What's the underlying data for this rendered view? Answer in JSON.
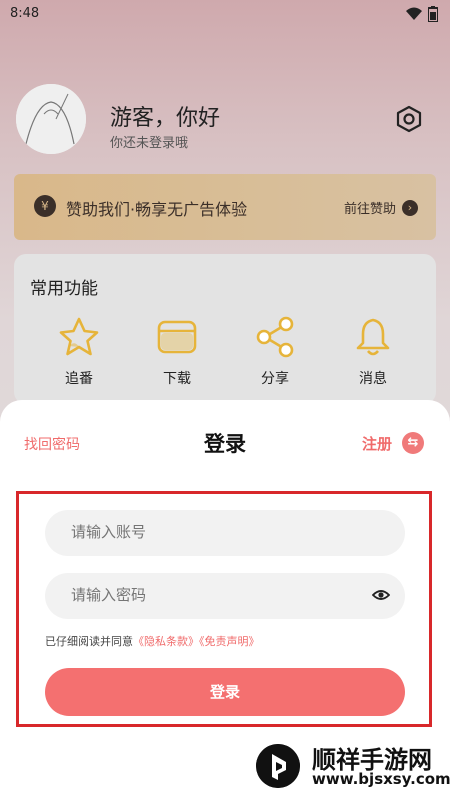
{
  "status_bar": {
    "time": "8:48"
  },
  "profile": {
    "greeting": "游客，你好",
    "subtitle": "你还未登录哦"
  },
  "sponsor": {
    "icon_text": "¥",
    "text": "赞助我们·畅享无广告体验",
    "action": "前往赞助"
  },
  "features": {
    "title": "常用功能",
    "items": [
      {
        "label": "追番",
        "icon": "star-icon"
      },
      {
        "label": "下载",
        "icon": "folder-icon"
      },
      {
        "label": "分享",
        "icon": "share-icon"
      },
      {
        "label": "消息",
        "icon": "bell-icon"
      }
    ]
  },
  "login_sheet": {
    "forgot": "找回密码",
    "title": "登录",
    "register": "注册",
    "account_placeholder": "请输入账号",
    "password_placeholder": "请输入密码",
    "agree_prefix": "已仔细阅读并同意",
    "privacy_link": "《隐私条款》",
    "disclaimer_link": "《免责声明》",
    "login_button": "登录"
  },
  "watermark": {
    "name": "顺祥手游网",
    "url": "www.bjsxsy.com"
  },
  "colors": {
    "accent": "#f47070",
    "feature_icon": "#e6b43a",
    "highlight_box": "#d8282a"
  }
}
